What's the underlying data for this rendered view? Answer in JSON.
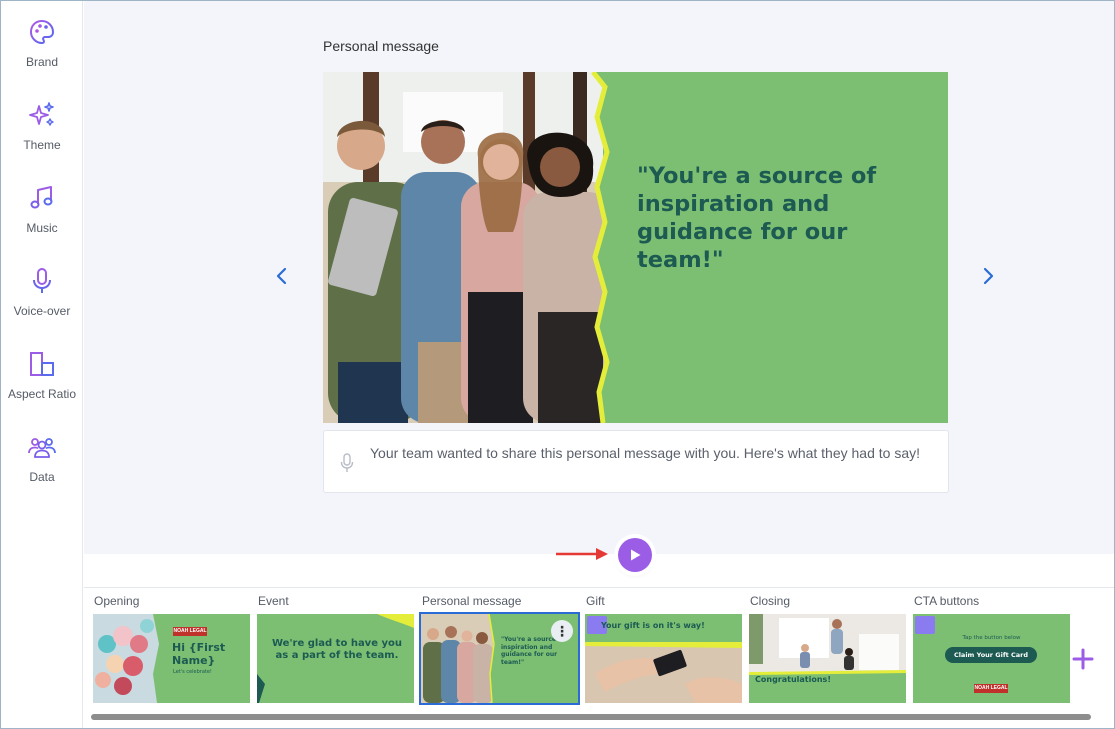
{
  "sidebar": {
    "items": [
      {
        "label": "Brand",
        "icon": "palette-icon"
      },
      {
        "label": "Theme",
        "icon": "sparkles-icon"
      },
      {
        "label": "Music",
        "icon": "music-note-icon"
      },
      {
        "label": "Voice-over",
        "icon": "microphone-icon"
      },
      {
        "label": "Aspect Ratio",
        "icon": "aspect-ratio-icon"
      },
      {
        "label": "Data",
        "icon": "users-icon"
      }
    ]
  },
  "editor": {
    "scene_title": "Personal message",
    "preview_quote": "\"You're a source of inspiration and guidance for our team!\"",
    "voiceover_text": "Your team wanted to share this personal message with you. Here's what they had to say!"
  },
  "timeline": {
    "scenes": [
      {
        "label": "Opening",
        "thumb_text": "Hi {First Name}",
        "thumb_sub": "Let's celebrate!",
        "logo": "NOAH LEGAL"
      },
      {
        "label": "Event",
        "thumb_text": "We're glad to have you as a part of the team."
      },
      {
        "label": "Personal message",
        "thumb_text": "\"You're a source of inspiration and guidance for our team!\"",
        "active": true
      },
      {
        "label": "Gift",
        "thumb_text": "Your gift is on it's way!"
      },
      {
        "label": "Closing",
        "thumb_text": "Congratulations!"
      },
      {
        "label": "CTA buttons",
        "thumb_text": "Tap the button below",
        "thumb_button": "Claim Your Gift Card",
        "logo": "NOAH LEGAL"
      }
    ]
  },
  "colors": {
    "accent": "#9b5de5",
    "slide_green": "#7cbf73",
    "slide_text": "#1c5a52",
    "nav_blue": "#2b6bd6",
    "annotation_red": "#e53935"
  }
}
